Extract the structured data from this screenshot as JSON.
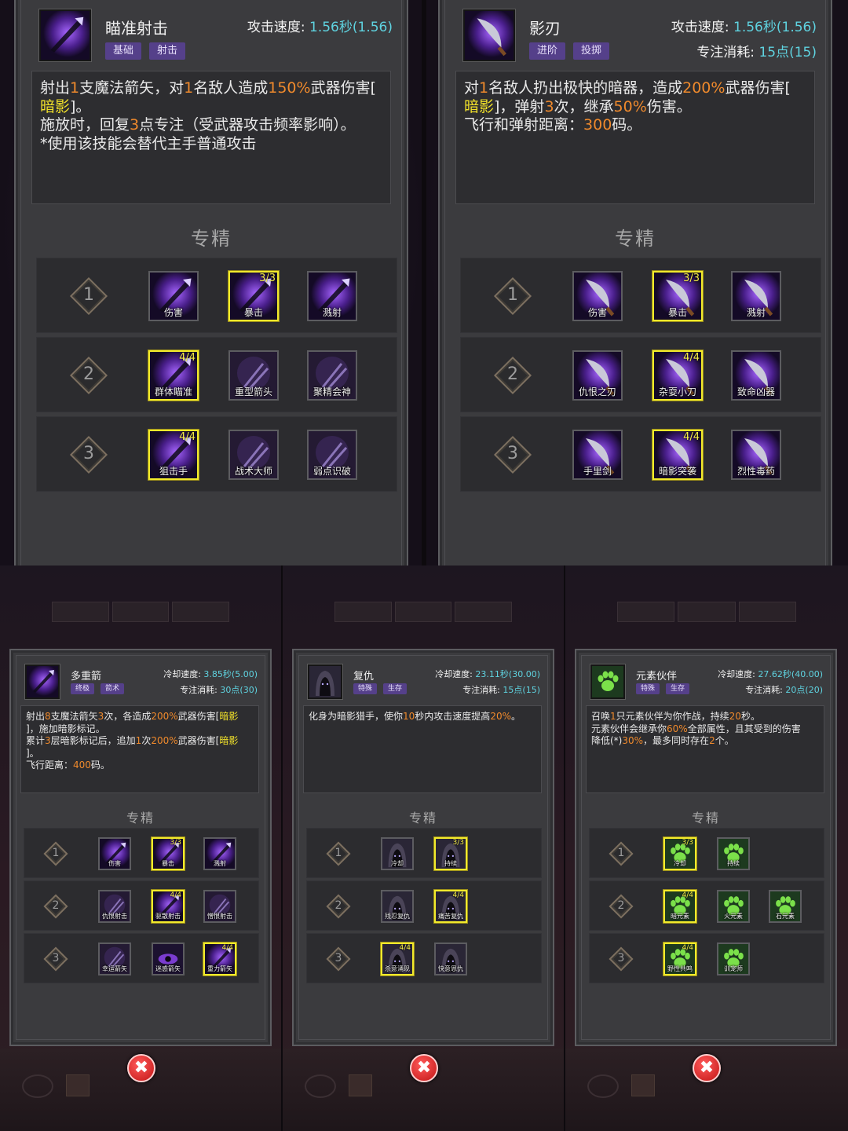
{
  "panels": [
    {
      "name": "瞄准射击",
      "tags": [
        "基础",
        "射击"
      ],
      "stat1_label": "攻击速度:",
      "stat1_value": "1.56秒",
      "stat1_extra": "(1.56)",
      "stat2_label": "",
      "stat2_value": "",
      "stat2_extra": "",
      "desc": [
        [
          {
            "t": "射出",
            "c": ""
          },
          {
            "t": "1",
            "c": "orange"
          },
          {
            "t": "支魔法箭矢，对",
            "c": ""
          },
          {
            "t": "1",
            "c": "orange"
          },
          {
            "t": "名敌人造成",
            "c": ""
          },
          {
            "t": "150%",
            "c": "orange"
          },
          {
            "t": "武器伤害[",
            "c": ""
          }
        ],
        [
          {
            "t": "暗影",
            "c": "yellow"
          },
          {
            "t": "]。",
            "c": ""
          }
        ],
        [
          {
            "t": "施放时，回复",
            "c": ""
          },
          {
            "t": "3",
            "c": "orange"
          },
          {
            "t": "点专注（受武器攻击频率影响）。",
            "c": ""
          }
        ],
        [
          {
            "t": "*使用该技能会替代主手普通攻击",
            "c": ""
          }
        ]
      ],
      "spec_title": "专精",
      "rows": [
        {
          "num": "1",
          "slots": [
            {
              "label": "伤害",
              "count": "",
              "active": false,
              "tone": "purple"
            },
            {
              "label": "暴击",
              "count": "3/3",
              "active": true,
              "tone": "purple"
            },
            {
              "label": "溅射",
              "count": "",
              "active": false,
              "tone": "purple"
            }
          ]
        },
        {
          "num": "2",
          "slots": [
            {
              "label": "群体瞄准",
              "count": "4/4",
              "active": true,
              "tone": "purple"
            },
            {
              "label": "重型箭头",
              "count": "",
              "active": false,
              "tone": "dark"
            },
            {
              "label": "聚精会神",
              "count": "",
              "active": false,
              "tone": "dark"
            }
          ]
        },
        {
          "num": "3",
          "slots": [
            {
              "label": "狙击手",
              "count": "4/4",
              "active": true,
              "tone": "purple"
            },
            {
              "label": "战术大师",
              "count": "",
              "active": false,
              "tone": "dark"
            },
            {
              "label": "弱点识破",
              "count": "",
              "active": false,
              "tone": "dark"
            }
          ]
        }
      ]
    },
    {
      "name": "影刃",
      "tags": [
        "进阶",
        "投掷"
      ],
      "stat1_label": "攻击速度:",
      "stat1_value": "1.56秒",
      "stat1_extra": "(1.56)",
      "stat2_label": "专注消耗:",
      "stat2_value": "15点",
      "stat2_extra": "(15)",
      "desc": [
        [
          {
            "t": "对",
            "c": ""
          },
          {
            "t": "1",
            "c": "orange"
          },
          {
            "t": "名敌人扔出极快的暗器，造成",
            "c": ""
          },
          {
            "t": "200%",
            "c": "orange"
          },
          {
            "t": "武器伤害[",
            "c": ""
          }
        ],
        [
          {
            "t": "暗影",
            "c": "yellow"
          },
          {
            "t": "]，弹射",
            "c": ""
          },
          {
            "t": "3",
            "c": "orange"
          },
          {
            "t": "次，继承",
            "c": ""
          },
          {
            "t": "50%",
            "c": "orange"
          },
          {
            "t": "伤害。",
            "c": ""
          }
        ],
        [
          {
            "t": "飞行和弹射距离：",
            "c": ""
          },
          {
            "t": "300",
            "c": "orange"
          },
          {
            "t": "码。",
            "c": ""
          }
        ]
      ],
      "spec_title": "专精",
      "rows": [
        {
          "num": "1",
          "slots": [
            {
              "label": "伤害",
              "count": "",
              "active": false,
              "tone": "blade"
            },
            {
              "label": "暴击",
              "count": "3/3",
              "active": true,
              "tone": "blade"
            },
            {
              "label": "溅射",
              "count": "",
              "active": false,
              "tone": "blade"
            }
          ]
        },
        {
          "num": "2",
          "slots": [
            {
              "label": "仇恨之刃",
              "count": "",
              "active": false,
              "tone": "blade"
            },
            {
              "label": "杂耍小刀",
              "count": "4/4",
              "active": true,
              "tone": "blade"
            },
            {
              "label": "致命凶器",
              "count": "",
              "active": false,
              "tone": "blade"
            }
          ]
        },
        {
          "num": "3",
          "slots": [
            {
              "label": "手里剑",
              "count": "",
              "active": false,
              "tone": "blade"
            },
            {
              "label": "暗影突袭",
              "count": "4/4",
              "active": true,
              "tone": "blade"
            },
            {
              "label": "烈性毒药",
              "count": "",
              "active": false,
              "tone": "blade"
            }
          ]
        }
      ]
    },
    {
      "name": "多重箭",
      "tags": [
        "终极",
        "箭术"
      ],
      "stat1_label": "冷却速度:",
      "stat1_value": "3.85秒",
      "stat1_extra": "(5.00)",
      "stat2_label": "专注消耗:",
      "stat2_value": "30点",
      "stat2_extra": "(30)",
      "desc": [
        [
          {
            "t": "射出",
            "c": ""
          },
          {
            "t": "8",
            "c": "orange"
          },
          {
            "t": "支魔法箭矢",
            "c": ""
          },
          {
            "t": "3",
            "c": "orange"
          },
          {
            "t": "次，各造成",
            "c": ""
          },
          {
            "t": "200%",
            "c": "orange"
          },
          {
            "t": "武器伤害[",
            "c": ""
          },
          {
            "t": "暗影",
            "c": "yellow"
          }
        ],
        [
          {
            "t": "]，施加暗影标记。",
            "c": ""
          }
        ],
        [
          {
            "t": "累计",
            "c": ""
          },
          {
            "t": "3",
            "c": "orange"
          },
          {
            "t": "层暗影标记后，追加",
            "c": ""
          },
          {
            "t": "1",
            "c": "orange"
          },
          {
            "t": "次",
            "c": ""
          },
          {
            "t": "200%",
            "c": "orange"
          },
          {
            "t": "武器伤害[",
            "c": ""
          },
          {
            "t": "暗影",
            "c": "yellow"
          }
        ],
        [
          {
            "t": "]。",
            "c": ""
          }
        ],
        [
          {
            "t": "飞行距离：",
            "c": ""
          },
          {
            "t": "400",
            "c": "orange"
          },
          {
            "t": "码。",
            "c": ""
          }
        ]
      ],
      "spec_title": "专精",
      "rows": [
        {
          "num": "1",
          "slots": [
            {
              "label": "伤害",
              "count": "",
              "active": false,
              "tone": "purple"
            },
            {
              "label": "暴击",
              "count": "3/3",
              "active": true,
              "tone": "purple"
            },
            {
              "label": "溅射",
              "count": "",
              "active": false,
              "tone": "purple"
            }
          ]
        },
        {
          "num": "2",
          "slots": [
            {
              "label": "仇恨射击",
              "count": "",
              "active": false,
              "tone": "dark"
            },
            {
              "label": "驱散射击",
              "count": "4/4",
              "active": true,
              "tone": "purple"
            },
            {
              "label": "憎恨射击",
              "count": "",
              "active": false,
              "tone": "dark"
            }
          ]
        },
        {
          "num": "3",
          "slots": [
            {
              "label": "幸运箭矢",
              "count": "",
              "active": false,
              "tone": "dark"
            },
            {
              "label": "迷惑箭矢",
              "count": "",
              "active": false,
              "tone": "eye"
            },
            {
              "label": "重力箭矢",
              "count": "4/4",
              "active": true,
              "tone": "purple"
            }
          ]
        }
      ]
    },
    {
      "name": "复仇",
      "tags": [
        "特殊",
        "生存"
      ],
      "stat1_label": "冷却速度:",
      "stat1_value": "23.11秒(",
      "stat1_extra": "30.00)",
      "stat2_label": "专注消耗:",
      "stat2_value": "15点",
      "stat2_extra": "(15)",
      "desc": [
        [
          {
            "t": "化身为暗影猎手，使你",
            "c": ""
          },
          {
            "t": "10",
            "c": "orange"
          },
          {
            "t": "秒内攻击速度提高",
            "c": ""
          },
          {
            "t": "20%",
            "c": "orange"
          },
          {
            "t": "。",
            "c": ""
          }
        ]
      ],
      "spec_title": "专精",
      "rows": [
        {
          "num": "1",
          "slots": [
            {
              "label": "冷却",
              "count": "",
              "active": false,
              "tone": "hood"
            },
            {
              "label": "持续",
              "count": "3/3",
              "active": true,
              "tone": "hood"
            }
          ]
        },
        {
          "num": "2",
          "slots": [
            {
              "label": "残忍复仇",
              "count": "",
              "active": false,
              "tone": "hood"
            },
            {
              "label": "痛苦复仇",
              "count": "4/4",
              "active": true,
              "tone": "hood"
            }
          ]
        },
        {
          "num": "3",
          "slots": [
            {
              "label": "杀意涌现",
              "count": "4/4",
              "active": true,
              "tone": "hood"
            },
            {
              "label": "快意恩仇",
              "count": "",
              "active": false,
              "tone": "hood"
            }
          ]
        }
      ]
    },
    {
      "name": "元素伙伴",
      "tags": [
        "特殊",
        "生存"
      ],
      "stat1_label": "冷却速度:",
      "stat1_value": "27.62秒(",
      "stat1_extra": "40.00)",
      "stat2_label": "专注消耗:",
      "stat2_value": "20点",
      "stat2_extra": "(20)",
      "desc": [
        [
          {
            "t": "召唤",
            "c": ""
          },
          {
            "t": "1",
            "c": "orange"
          },
          {
            "t": "只元素伙伴为你作战，持续",
            "c": ""
          },
          {
            "t": "20",
            "c": "orange"
          },
          {
            "t": "秒。",
            "c": ""
          }
        ],
        [
          {
            "t": "元素伙伴会继承你",
            "c": ""
          },
          {
            "t": "60%",
            "c": "orange"
          },
          {
            "t": "全部属性，且其受到的伤害",
            "c": ""
          }
        ],
        [
          {
            "t": "降低(*)",
            "c": ""
          },
          {
            "t": "30%",
            "c": "orange"
          },
          {
            "t": "，最多同时存在",
            "c": ""
          },
          {
            "t": "2",
            "c": "orange"
          },
          {
            "t": "个。",
            "c": ""
          }
        ]
      ],
      "spec_title": "专精",
      "rows": [
        {
          "num": "1",
          "slots": [
            {
              "label": "冷却",
              "count": "3/3",
              "active": true,
              "tone": "paw"
            },
            {
              "label": "持续",
              "count": "",
              "active": false,
              "tone": "paw"
            }
          ]
        },
        {
          "num": "2",
          "slots": [
            {
              "label": "暗元素",
              "count": "4/4",
              "active": true,
              "tone": "paw"
            },
            {
              "label": "火元素",
              "count": "",
              "active": false,
              "tone": "paw"
            },
            {
              "label": "石元素",
              "count": "",
              "active": false,
              "tone": "paw"
            }
          ]
        },
        {
          "num": "3",
          "slots": [
            {
              "label": "野性共鸣",
              "count": "4/4",
              "active": true,
              "tone": "paw"
            },
            {
              "label": "训宠师",
              "count": "",
              "active": false,
              "tone": "paw"
            }
          ]
        }
      ]
    }
  ],
  "close_icon": "close-icon",
  "colors": {
    "accent_yellow": "#f2ea2c",
    "tag_purple": "#55408a",
    "value_cyan": "#5fd3e0",
    "value_orange": "#f08a2c",
    "close_red": "#d21b1b"
  }
}
